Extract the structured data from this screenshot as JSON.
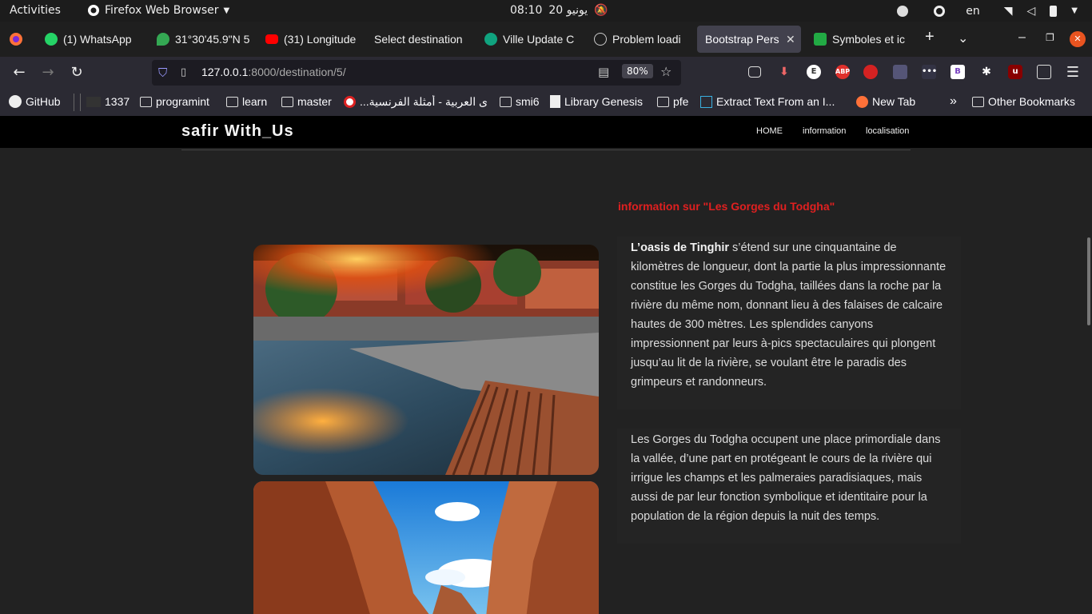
{
  "system": {
    "activities": "Activities",
    "app_name": "Firefox Web Browser",
    "clock": "08:10",
    "date": "20 يونيو",
    "lang": "en"
  },
  "tabs": [
    {
      "label": "(1) WhatsApp",
      "color": "#25d366"
    },
    {
      "label": "31°30'45.9\"N 5",
      "color": "#34a853"
    },
    {
      "label": "(31) Longitude",
      "color": "#ff0000"
    },
    {
      "label": "Select destination",
      "color": ""
    },
    {
      "label": "Ville Update C",
      "color": "#10a37f"
    },
    {
      "label": "Problem loadi",
      "color": "#cccccc"
    },
    {
      "label": "Bootstrap Pers",
      "color": "",
      "active": true
    },
    {
      "label": "Symboles et ic",
      "color": "#22aa44"
    }
  ],
  "toolbar": {
    "url_host": "127.0.0.1",
    "url_path": ":8000/destination/5/",
    "zoom": "80%"
  },
  "bookmarks": [
    {
      "label": "GitHub",
      "icon": "github-icon"
    },
    {
      "label": "1337",
      "icon": "site-icon"
    },
    {
      "label": "programint",
      "icon": "folder-icon"
    },
    {
      "label": "learn",
      "icon": "folder-icon"
    },
    {
      "label": "master",
      "icon": "folder-icon"
    },
    {
      "label": "...ى العربية - أمثلة الفرنسية",
      "icon": "site-icon"
    },
    {
      "label": "smi6",
      "icon": "folder-icon"
    },
    {
      "label": "Library Genesis",
      "icon": "site-icon"
    },
    {
      "label": "pfe",
      "icon": "folder-icon"
    },
    {
      "label": "Extract Text From an I...",
      "icon": "site-icon"
    },
    {
      "label": "New Tab",
      "icon": "firefox-icon"
    },
    {
      "label": "Other Bookmarks",
      "icon": "folder-icon"
    }
  ],
  "site": {
    "brand": "safir With_Us",
    "nav": [
      "HOME",
      "information",
      "localisation"
    ],
    "info_title": "information sur \"Les Gorges du Todgha\"",
    "para1_bold": "L’oasis de Tinghir",
    "para1_rest": " s’étend sur une cinquantaine de kilomètres de longueur, dont la partie la plus impressionnante constitue les Gorges du Todgha, taillées dans la roche par la rivière du même nom, donnant lieu à des falaises de calcaire hautes de 300 mètres. Les splendides canyons impressionnent par leurs à-pics spectaculaires qui plongent jusqu’au lit de la rivière, se voulant être le paradis des grimpeurs et randonneurs.",
    "para2": "Les Gorges du Todgha occupent une place primordiale dans la vallée, d’une part en protégeant le cours de la rivière qui irrigue les champs et les palmeraies paradisiaques, mais aussi de par leur fonction symbolique et identitaire pour la population de la région depuis la nuit des temps."
  }
}
